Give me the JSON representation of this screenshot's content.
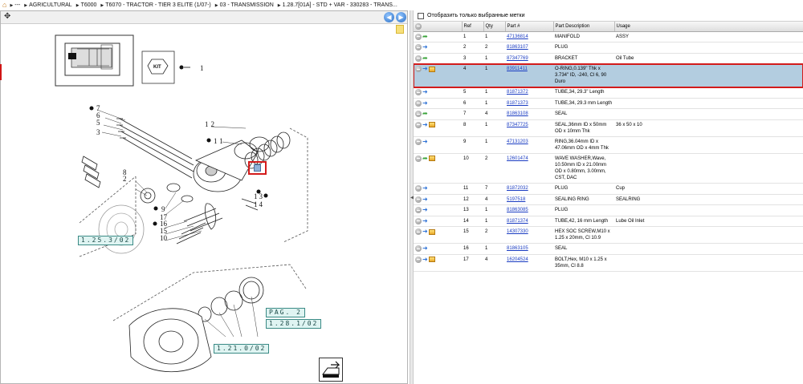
{
  "breadcrumb": {
    "items": [
      "---",
      "AGRICULTURAL",
      "T6000",
      "T6070 - TRACTOR - TIER 3 ELITE (1/07-)",
      "03 - TRANSMISSION",
      "1.28.7[01A] - STD + VAR - 330283 - TRANS..."
    ]
  },
  "diagram": {
    "kit_label": "KIT",
    "kit_qty": "1",
    "callouts": [
      "1.25.3/02",
      "PAG. 2",
      "1.28.1/02",
      "1.21.0/02"
    ],
    "ref_labels": [
      "7",
      "6",
      "5",
      "3",
      "12",
      "11",
      "8",
      "2",
      "9",
      "17",
      "16",
      "15",
      "10",
      "13",
      "14"
    ]
  },
  "filter": {
    "label": "Отобразить только выбранные метки"
  },
  "table": {
    "headers": [
      "",
      "Ref",
      "Qty",
      "Part #",
      "Part Description",
      "Usage"
    ],
    "rows": [
      {
        "ref": "1",
        "qty": "1",
        "part": "47136814",
        "desc": "MANIFOLD",
        "usage": "ASSY",
        "icon": "green"
      },
      {
        "ref": "2",
        "qty": "2",
        "part": "81863107",
        "desc": "PLUG",
        "usage": "",
        "icon": "blue"
      },
      {
        "ref": "3",
        "qty": "1",
        "part": "87347769",
        "desc": "BRACKET",
        "usage": "Oil Tube",
        "icon": "green"
      },
      {
        "ref": "4",
        "qty": "1",
        "part": "83911411",
        "desc": "O-RING,0.139\" Thk x 3.734\" ID, -240, Cl 6, 90 Duro",
        "usage": "",
        "icon": "blue-box",
        "selected": true
      },
      {
        "ref": "5",
        "qty": "1",
        "part": "81871372",
        "desc": "TUBE,34, 29.3\" Length",
        "usage": "",
        "icon": "blue"
      },
      {
        "ref": "6",
        "qty": "1",
        "part": "81871373",
        "desc": "TUBE,34, 29.3 mm Length",
        "usage": "",
        "icon": "blue"
      },
      {
        "ref": "7",
        "qty": "4",
        "part": "81863108",
        "desc": "SEAL",
        "usage": "",
        "icon": "green"
      },
      {
        "ref": "8",
        "qty": "1",
        "part": "87347725",
        "desc": "SEAL,36mm ID x 50mm OD x 10mm Thk",
        "usage": "36 x 50 x 10",
        "icon": "blue-box"
      },
      {
        "ref": "9",
        "qty": "1",
        "part": "47131203",
        "desc": "RING,36.04mm ID x 47.06mm OD x 4mm Thk",
        "usage": "",
        "icon": "blue"
      },
      {
        "ref": "10",
        "qty": "2",
        "part": "12601474",
        "desc": "WAVE WASHER,Wave, 10.50mm ID x 21.00mm OD x 0.80mm, 3.00mm, CST, DAC",
        "usage": "",
        "icon": "green-box"
      },
      {
        "ref": "11",
        "qty": "7",
        "part": "81872032",
        "desc": "PLUG",
        "usage": "Cup",
        "icon": "blue"
      },
      {
        "ref": "12",
        "qty": "4",
        "part": "5197518",
        "desc": "SEALING RING",
        "usage": "SEALRING",
        "icon": "blue"
      },
      {
        "ref": "13",
        "qty": "1",
        "part": "81863085",
        "desc": "PLUG",
        "usage": "",
        "icon": "blue"
      },
      {
        "ref": "14",
        "qty": "1",
        "part": "81871374",
        "desc": "TUBE,42, 16 mm Length",
        "usage": "Lube Oil Inlet",
        "icon": "blue"
      },
      {
        "ref": "15",
        "qty": "2",
        "part": "14307330",
        "desc": "HEX SOC SCREW,M10 x 1.25 x 20mm, Cl 10.9",
        "usage": "",
        "icon": "blue-box"
      },
      {
        "ref": "16",
        "qty": "1",
        "part": "81863105",
        "desc": "SEAL",
        "usage": "",
        "icon": "blue"
      },
      {
        "ref": "17",
        "qty": "4",
        "part": "16204524",
        "desc": "BOLT,Hex, M10 x 1.25 x 35mm, Cl 8.8",
        "usage": "",
        "icon": "blue-box"
      }
    ]
  },
  "colors": {
    "selected_row": "#b3cde0",
    "highlight_border": "#d31b1b",
    "link": "#1a3cc2",
    "callout_bg": "#dff4f2"
  }
}
